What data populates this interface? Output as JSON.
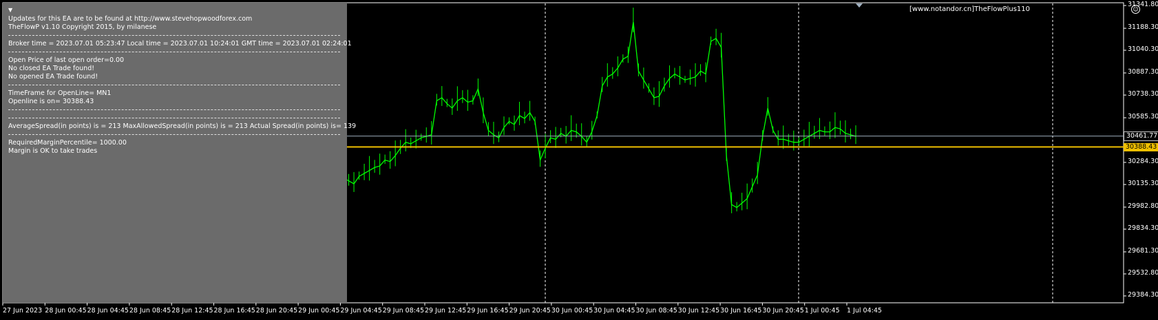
{
  "info_panel": {
    "lines": [
      "Updates for this EA are to be found at http://www.stevehopwoodforex.com",
      "TheFlowP  v1.10 Copyright 2015, by milanese",
      "Broker time = 2023.07.01 05:23:47 Local time = 2023.07.01 10:24:01 GMT time = 2023.07.01 02:24:01",
      "Open Price of last open order=0.00",
      "No closed EA Trade found!",
      "No opened EA Trade found!",
      "TimeFrame for OpenLine= MN1",
      "Openline is on= 30388.43",
      "AverageSpread(in points) is = 213 MaxAllowedSpread(in points) is = 213 Actual Spread(in points) is= 139",
      "RequiredMarginPercentile= 1000.00",
      "Margin is OK to take trades"
    ]
  },
  "watermark": "[www.notandor.cn]TheFlowPlus110",
  "price_axis": {
    "labels": [
      "31341.80",
      "31188.30",
      "31040.30",
      "30887.30",
      "30738.30",
      "30585.30",
      "30284.30",
      "30135.30",
      "29982.80",
      "29834.30",
      "29681.30",
      "29532.80",
      "29384.30"
    ]
  },
  "time_axis": {
    "labels": [
      "27 Jun 2023",
      "28 Jun 00:45",
      "28 Jun 04:45",
      "28 Jun 08:45",
      "28 Jun 12:45",
      "28 Jun 16:45",
      "28 Jun 20:45",
      "29 Jun 00:45",
      "29 Jun 04:45",
      "29 Jun 08:45",
      "29 Jun 12:45",
      "29 Jun 16:45",
      "29 Jun 20:45",
      "30 Jun 00:45",
      "30 Jun 04:45",
      "30 Jun 08:45",
      "30 Jun 12:45",
      "30 Jun 16:45",
      "30 Jun 20:45",
      "1 Jul 00:45",
      "1 Jul 04:45"
    ]
  },
  "current_bid": "30461.77",
  "openline_price": "30388.43",
  "colors": {
    "background": "#000000",
    "panel": "#6b6b6b",
    "candle": "#00ff00",
    "openline": "#f0c000",
    "bidline": "#a0b0c0",
    "grid_separator": "#ffffff"
  },
  "chart_data": {
    "type": "line",
    "title": "",
    "xlabel": "",
    "ylabel": "",
    "ylim": [
      29384.3,
      31341.8
    ],
    "series": [
      {
        "values": [
          30120,
          30240,
          30180,
          30160,
          30140,
          30190,
          30210,
          30230,
          30250,
          30260,
          30300,
          30290,
          30330,
          30380,
          30420,
          30410,
          30430,
          30450,
          30460,
          30470,
          30700,
          30720,
          30680,
          30650,
          30700,
          30720,
          30690,
          30700,
          30780,
          30620,
          30500,
          30470,
          30450,
          30520,
          30560,
          30540,
          30600,
          30580,
          30620,
          30560,
          30300,
          30380,
          30450,
          30440,
          30480,
          30460,
          30500,
          30490,
          30460,
          30420,
          30490,
          30600,
          30800,
          30860,
          30880,
          30920,
          30980,
          31000,
          31230,
          30900,
          30840,
          30780,
          30720,
          30730,
          30800,
          30850,
          30880,
          30860,
          30840,
          30850,
          30860,
          30900,
          30880,
          31100,
          31120,
          31060,
          30330,
          30000,
          29980,
          30010,
          30040,
          30120,
          30200,
          30460,
          30650,
          30500,
          30440,
          30440,
          30430,
          30420,
          30420,
          30440,
          30460,
          30480,
          30500,
          30490,
          30490,
          30520,
          30510,
          30480,
          30470,
          30460
        ]
      }
    ]
  }
}
